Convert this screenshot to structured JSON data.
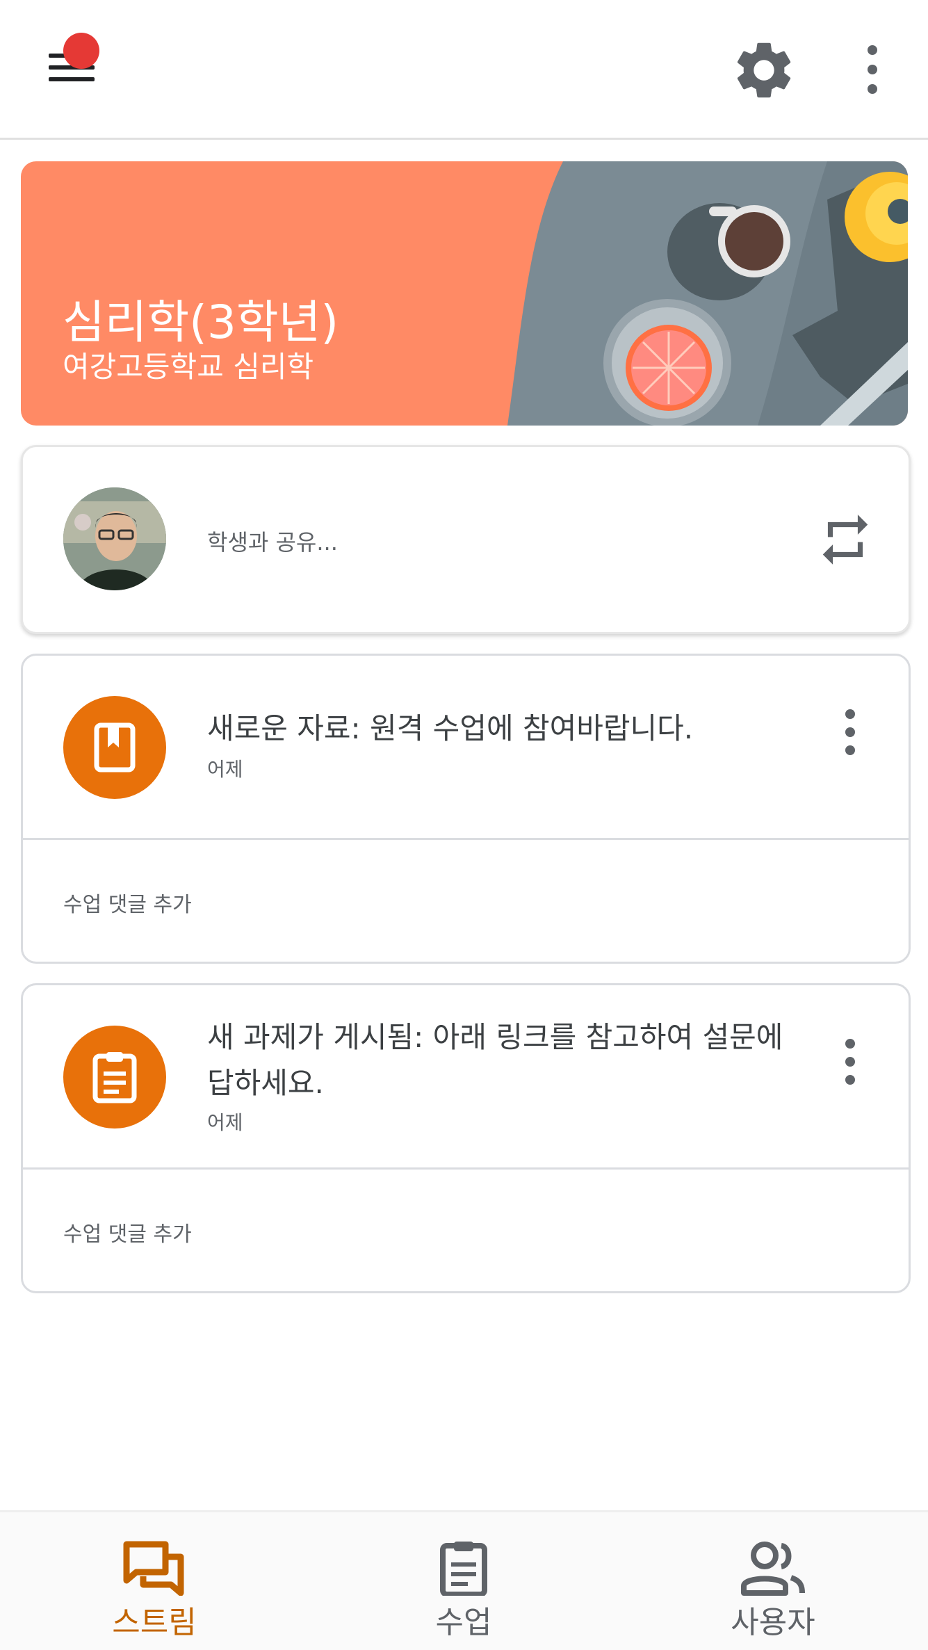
{
  "header": {
    "menu_icon": "menu-icon",
    "notification_badge_color": "#e53935",
    "settings_icon": "gear-icon",
    "more_icon": "more-vert-icon"
  },
  "banner": {
    "title": "심리학(3학년)",
    "subtitle": "여강고등학교 심리학",
    "color": "#ff8a65"
  },
  "share": {
    "placeholder": "학생과 공유...",
    "repost_icon": "repost-icon"
  },
  "posts": [
    {
      "icon": "material-book-icon",
      "title": "새로운 자료: 원격 수업에 참여바랍니다.",
      "date": "어제",
      "comment_label": "수업 댓글 추가"
    },
    {
      "icon": "assignment-clipboard-icon",
      "title": "새 과제가 게시됨: 아래 링크를 참고하여 설문에 답하세요.",
      "date": "어제",
      "comment_label": "수업 댓글 추가"
    }
  ],
  "accent_color": "#e8710a",
  "bottom_nav": [
    {
      "label": "스트림",
      "icon": "stream-icon",
      "active": true
    },
    {
      "label": "수업",
      "icon": "classwork-icon",
      "active": false
    },
    {
      "label": "사용자",
      "icon": "people-icon",
      "active": false
    }
  ]
}
